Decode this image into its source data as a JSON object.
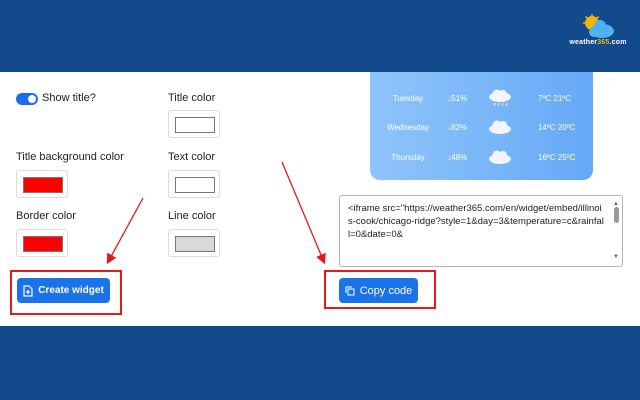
{
  "logo": {
    "brand_prefix": "weather",
    "brand_number": "365",
    "brand_suffix": ".com",
    "sun_color": "#f5b400",
    "cloud_color": "#4db1f2"
  },
  "form": {
    "show_title": {
      "label": "Show title?",
      "checked": true
    },
    "fields": [
      {
        "label": "Title color",
        "value": "#ffffff"
      },
      {
        "label": "Title background color",
        "value": "#ff0000"
      },
      {
        "label": "Text color",
        "value": "#ffffff"
      },
      {
        "label": "Border color",
        "value": "#ff0000"
      },
      {
        "label": "Line color",
        "value": "#d9d9d9"
      }
    ]
  },
  "buttons": {
    "create_widget": "Create widget",
    "copy_code": "Copy code"
  },
  "weather_preview": {
    "rows": [
      {
        "day": "Tuesday",
        "rain": "51%",
        "icon": "rain-cloud-icon",
        "low": "7ºC",
        "high": "21ºC"
      },
      {
        "day": "Wednesday",
        "rain": "82%",
        "icon": "cloud-icon",
        "low": "14ºC",
        "high": "20ºC"
      },
      {
        "day": "Thursday",
        "rain": "48%",
        "icon": "cloud-icon",
        "low": "16ºC",
        "high": "25ºC"
      }
    ]
  },
  "embed_code": "<iframe src=\"https://weather365.com/en/widget/embed/illinois-cook/chicago-ridge?style=1&day=3&temperature=c&rainfall=0&date=0&",
  "colors": {
    "accent": "#1a73e8",
    "highlight": "#e01b1b",
    "background": "#124a8c"
  }
}
